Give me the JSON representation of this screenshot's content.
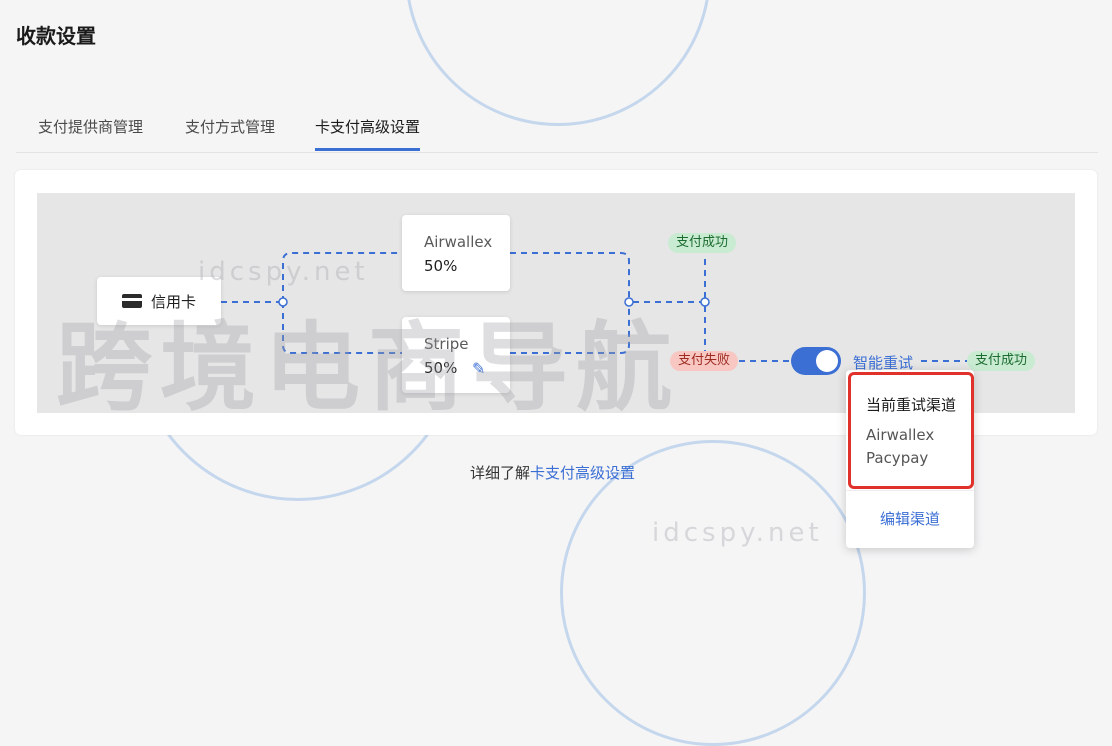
{
  "page": {
    "title": "收款设置"
  },
  "tabs": [
    {
      "label": "支付提供商管理"
    },
    {
      "label": "支付方式管理"
    },
    {
      "label": "卡支付高级设置",
      "active": true
    }
  ],
  "flow": {
    "source": {
      "label": "信用卡",
      "icon": "credit-card-icon"
    },
    "providers": [
      {
        "name": "Airwallex",
        "share": "50%"
      },
      {
        "name": "Stripe",
        "share": "50%",
        "editable": true
      }
    ],
    "success_badge": "支付成功",
    "fail_badge": "支付失败",
    "retry_toggle_on": true,
    "retry_label": "智能重试",
    "retry_success_badge": "支付成功"
  },
  "learn_more": {
    "prefix": "详细了解",
    "link": "卡支付高级设置"
  },
  "popover": {
    "title": "当前重试渠道",
    "channels": [
      "Airwallex",
      "Pacypay"
    ],
    "edit_label": "编辑渠道"
  },
  "watermark": {
    "text": "跨境电商导航",
    "url": "idcspy.net"
  },
  "colors": {
    "accent": "#3b6fd4",
    "success_bg": "#c8ebd2",
    "fail_bg": "#f8c7c2",
    "highlight": "#e0322b"
  }
}
